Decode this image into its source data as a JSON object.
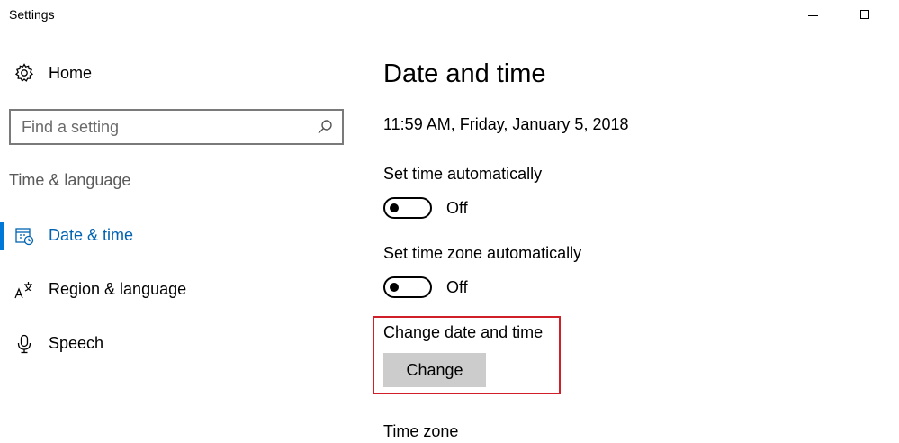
{
  "window": {
    "title": "Settings",
    "controls": [
      "minimize",
      "maximize"
    ]
  },
  "sidebar": {
    "home_label": "Home",
    "search": {
      "placeholder": "Find a setting",
      "value": ""
    },
    "section_label": "Time & language",
    "items": [
      {
        "label": "Date & time",
        "icon": "calendar-clock-icon",
        "active": true
      },
      {
        "label": "Region & language",
        "icon": "region-language-icon",
        "active": false
      },
      {
        "label": "Speech",
        "icon": "microphone-icon",
        "active": false
      }
    ]
  },
  "main": {
    "title": "Date and time",
    "current_datetime": "11:59 AM, Friday, January 5, 2018",
    "set_time_auto": {
      "label": "Set time automatically",
      "state": "Off"
    },
    "set_timezone_auto": {
      "label": "Set time zone automatically",
      "state": "Off"
    },
    "change_date_time": {
      "label": "Change date and time",
      "button_label": "Change"
    },
    "time_zone_label": "Time zone"
  },
  "colors": {
    "accent": "#0078d7",
    "active_text": "#0063b1",
    "highlight": "#d11f2a",
    "button_bg": "#cccccc"
  }
}
